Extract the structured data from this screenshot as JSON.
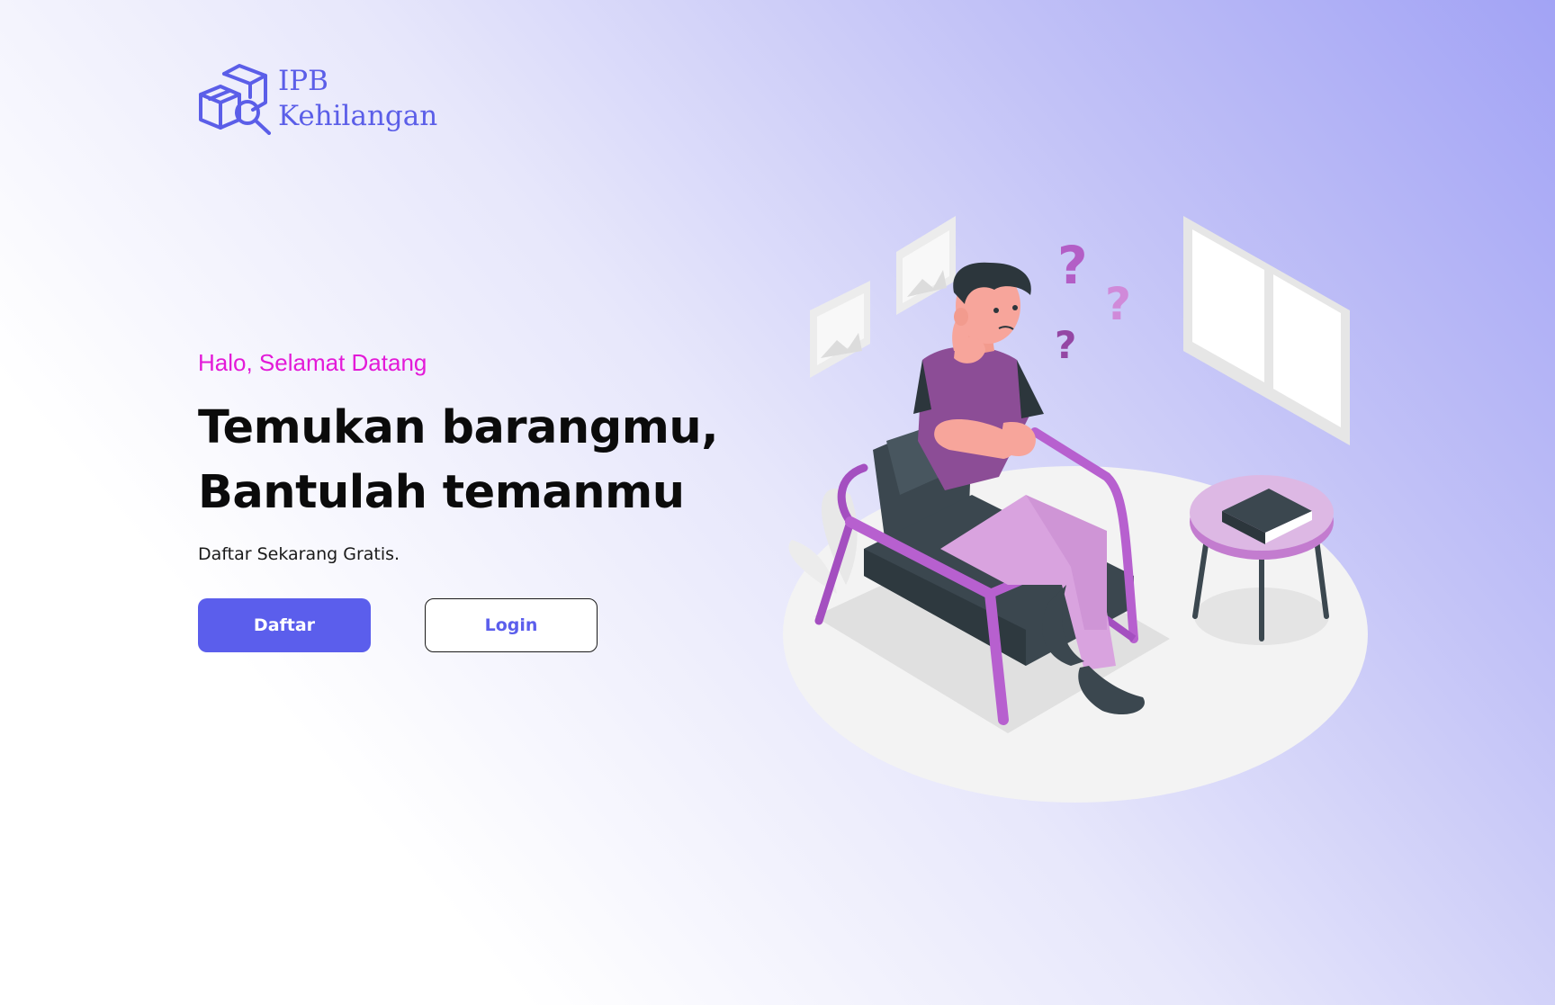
{
  "brand": {
    "line1": "IPB",
    "line2": "Kehilangan",
    "logo_icon": "box-search-icon",
    "color": "#5b5ee8"
  },
  "hero": {
    "greeting": "Halo, Selamat Datang",
    "headline_line1": "Temukan barangmu,",
    "headline_line2": "Bantulah temanmu",
    "subtext": "Daftar Sekarang Gratis.",
    "greeting_color": "#e31ad8"
  },
  "buttons": {
    "register_label": "Daftar",
    "login_label": "Login",
    "accent": "#5b5eec"
  },
  "illustration": {
    "icon": "confused-person-in-chair-illustration"
  }
}
